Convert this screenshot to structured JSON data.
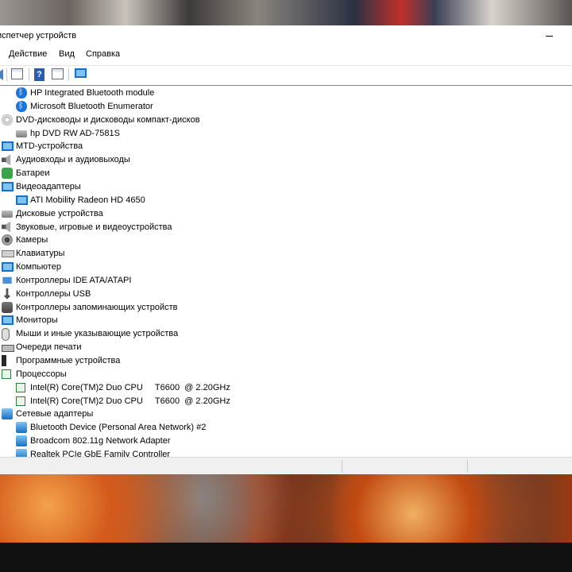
{
  "window": {
    "title": "испетчер устройств"
  },
  "menu": [
    "Действие",
    "Вид",
    "Справка"
  ],
  "toolbar_icons": [
    "back-icon",
    "properties-icon",
    "help-icon",
    "view-icon",
    "monitor-icon"
  ],
  "tree": [
    {
      "label": "HP Integrated Bluetooth module",
      "icon": "bluetooth-icon"
    },
    {
      "label": "Microsoft Bluetooth Enumerator",
      "icon": "bluetooth-icon"
    },
    {
      "label": "DVD-дисководы и дисководы компакт-дисков",
      "icon": "disc-icon"
    },
    {
      "label": "hp DVD RW AD-7581S",
      "icon": "drive-icon"
    },
    {
      "label": "MTD-устройства",
      "icon": "monitor-icon"
    },
    {
      "label": "Аудиовходы и аудиовыходы",
      "icon": "speaker-icon"
    },
    {
      "label": "Батареи",
      "icon": "battery-icon"
    },
    {
      "label": "Видеоадаптеры",
      "icon": "display-adapter-icon"
    },
    {
      "label": "ATI Mobility Radeon HD 4650",
      "icon": "display-adapter-icon"
    },
    {
      "label": "Дисковые устройства",
      "icon": "drive-icon"
    },
    {
      "label": "Звуковые, игровые и видеоустройства",
      "icon": "speaker-icon"
    },
    {
      "label": "Камеры",
      "icon": "camera-icon"
    },
    {
      "label": "Клавиатуры",
      "icon": "keyboard-icon"
    },
    {
      "label": "Компьютер",
      "icon": "computer-icon"
    },
    {
      "label": "Контроллеры IDE ATA/ATAPI",
      "icon": "ide-icon"
    },
    {
      "label": "Контроллеры USB",
      "icon": "usb-icon"
    },
    {
      "label": "Контроллеры запоминающих устройств",
      "icon": "storage-icon"
    },
    {
      "label": "Мониторы",
      "icon": "monitor-icon"
    },
    {
      "label": "Мыши и иные указывающие устройства",
      "icon": "mouse-icon"
    },
    {
      "label": "Очереди печати",
      "icon": "printer-icon"
    },
    {
      "label": "Программные устройства",
      "icon": "software-device-icon"
    },
    {
      "label": "Процессоры",
      "icon": "cpu-icon"
    },
    {
      "label": "Intel(R) Core(TM)2 Duo CPU     T6600  @ 2.20GHz",
      "icon": "cpu-icon"
    },
    {
      "label": "Intel(R) Core(TM)2 Duo CPU     T6600  @ 2.20GHz",
      "icon": "cpu-icon"
    },
    {
      "label": "Сетевые адаптеры",
      "icon": "network-icon"
    },
    {
      "label": "Bluetooth Device (Personal Area Network) #2",
      "icon": "network-icon"
    },
    {
      "label": "Broadcom 802.11g Network Adapter",
      "icon": "network-icon"
    },
    {
      "label": "Realtek PCIe GbE Family Controller",
      "icon": "network-icon"
    }
  ]
}
